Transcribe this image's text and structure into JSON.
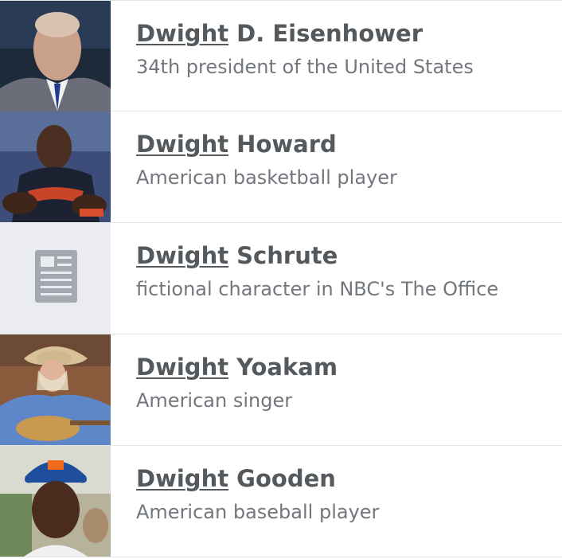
{
  "results": [
    {
      "title_match": "Dwight",
      "title_rest": " D. Eisenhower",
      "description": "34th president of the United States",
      "thumbnail": "photo"
    },
    {
      "title_match": "Dwight",
      "title_rest": " Howard",
      "description": "American basketball player",
      "thumbnail": "photo"
    },
    {
      "title_match": "Dwight",
      "title_rest": " Schrute",
      "description": "fictional character in NBC's The Office",
      "thumbnail": "article-placeholder-icon"
    },
    {
      "title_match": "Dwight",
      "title_rest": " Yoakam",
      "description": "American singer",
      "thumbnail": "photo"
    },
    {
      "title_match": "Dwight",
      "title_rest": " Gooden",
      "description": "American baseball player",
      "thumbnail": "photo"
    }
  ],
  "colors": {
    "title": "#54595d",
    "description": "#72777d",
    "divider": "#e6e6e6",
    "placeholder_bg": "#eaecf0",
    "placeholder_icon": "#a2a9b1"
  }
}
